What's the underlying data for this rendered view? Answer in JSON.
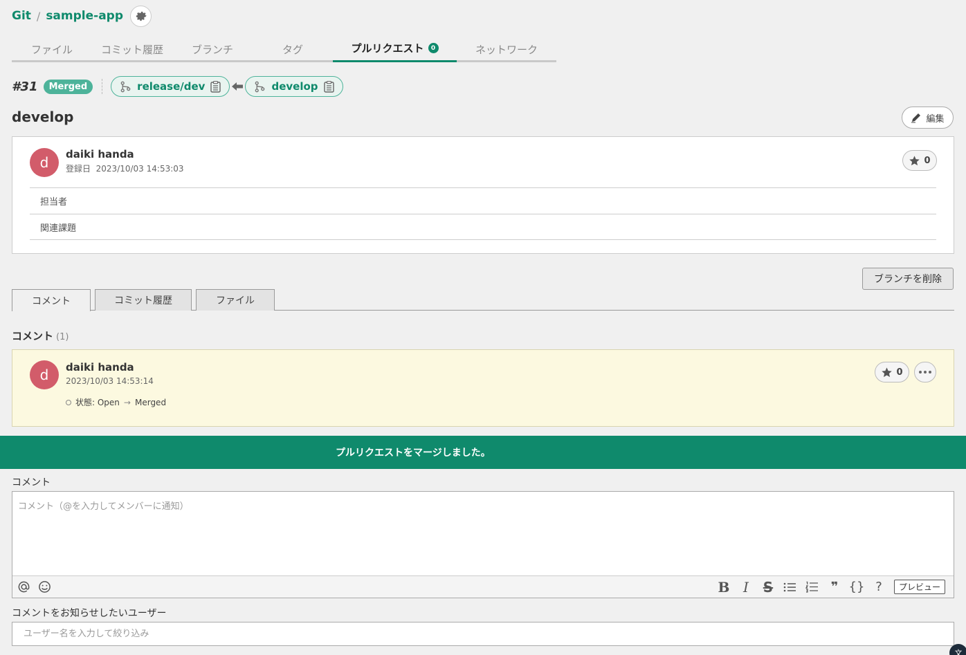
{
  "breadcrumb": {
    "root": "Git",
    "sep": "/",
    "repo": "sample-app"
  },
  "tabs": [
    {
      "label": "ファイル"
    },
    {
      "label": "コミット履歴"
    },
    {
      "label": "ブランチ"
    },
    {
      "label": "タグ"
    },
    {
      "label": "プルリクエスト",
      "count": "0",
      "active": true
    },
    {
      "label": "ネットワーク"
    }
  ],
  "pr": {
    "number": "#31",
    "status": "Merged",
    "target_branch": "release/dev",
    "source_branch": "develop",
    "title": "develop",
    "edit_label": "編集",
    "author": "daiki handa",
    "avatar_letter": "d",
    "registered_label": "登録日",
    "registered_at": "2023/10/03 14:53:03",
    "stars": "0",
    "assignee_label": "担当者",
    "related_issue_label": "関連課題"
  },
  "delete_branch_label": "ブランチを削除",
  "sub_tabs": [
    {
      "label": "コメント",
      "active": true
    },
    {
      "label": "コミット履歴"
    },
    {
      "label": "ファイル"
    }
  ],
  "comments": {
    "heading": "コメント",
    "count": "(1)",
    "items": [
      {
        "author": "daiki handa",
        "avatar_letter": "d",
        "date": "2023/10/03 14:53:14",
        "status_label": "状態: Open",
        "status_arrow": "→",
        "status_new": "Merged",
        "stars": "0"
      }
    ]
  },
  "toast": {
    "message": "プルリクエストをマージしました。"
  },
  "comment_form": {
    "label": "コメント",
    "placeholder": "コメント（@を入力してメンバーに通知）",
    "toolbar": {
      "bold": "B",
      "italic": "I",
      "strike": "S",
      "quote": "❞",
      "code": "{}",
      "help": "?",
      "preview": "プレビュー"
    }
  },
  "notify": {
    "label": "コメントをお知らせしたいユーザー",
    "placeholder": "ユーザー名を入力して絞り込み"
  },
  "lang_badge": "文",
  "colors": {
    "accent": "#0f8a6c",
    "merged": "#4db39a",
    "avatar": "#d25c6a",
    "comment_bg": "#fcf9e0"
  }
}
